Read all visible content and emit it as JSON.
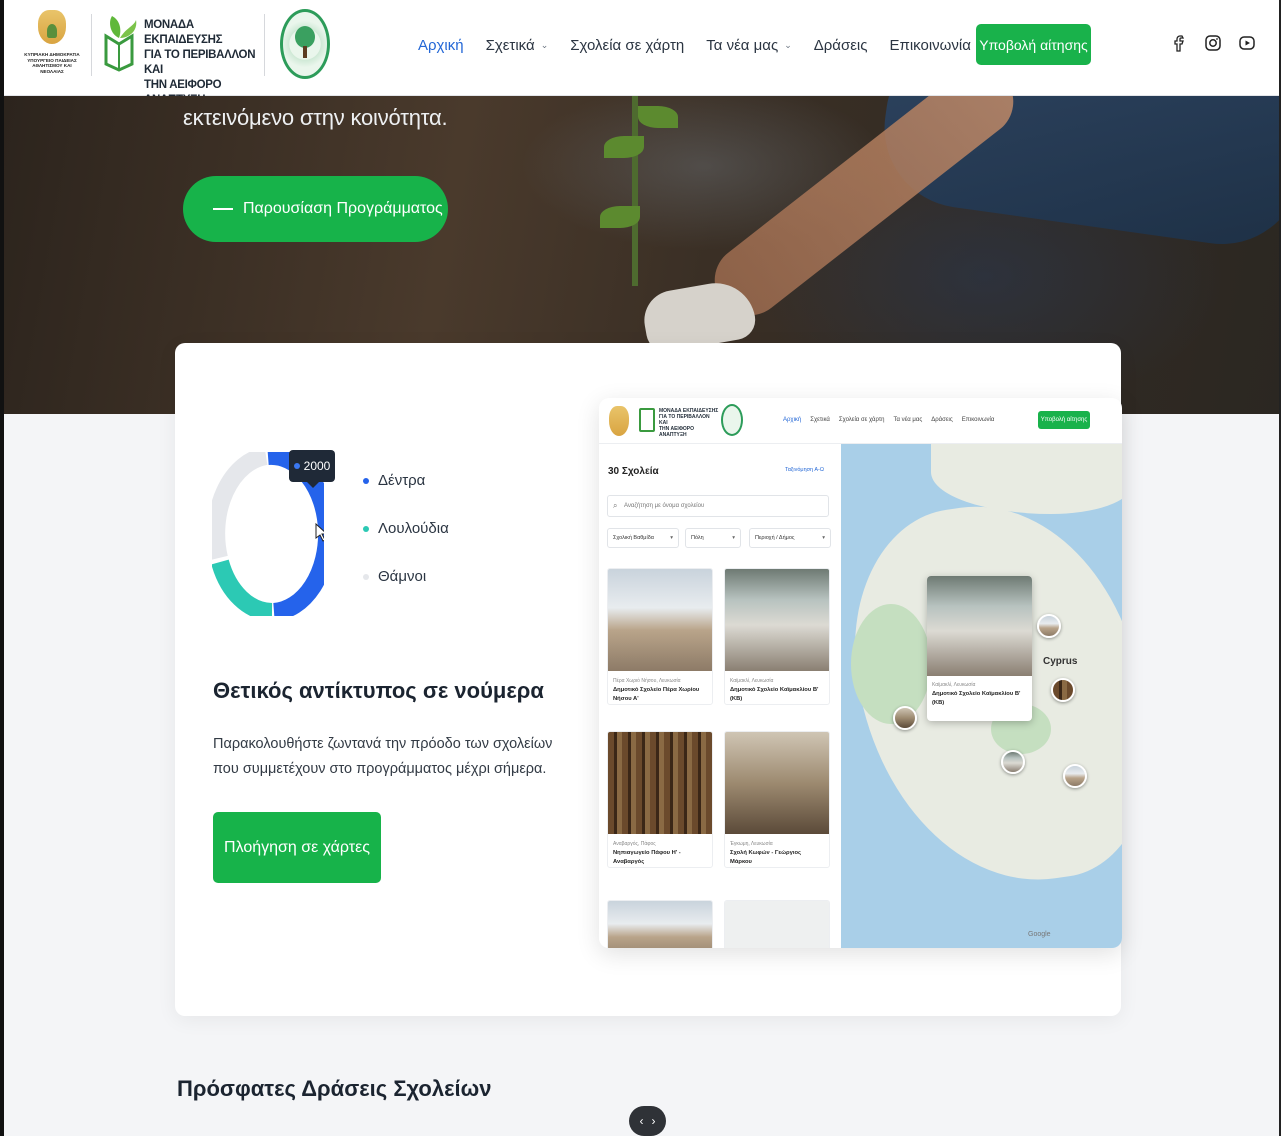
{
  "header": {
    "gov_logo_text": "ΚΥΠΡΙΑΚΗ ΔΗΜΟΚΡΑΤΙΑ ΥΠΟΥΡΓΕΙΟ ΠΑΙΔΕΙΑΣ ΑΘΛΗΤΙΣΜΟΥ ΚΑΙ ΝΕΟΛΑΙΑΣ",
    "unit_name_line1": "ΜΟΝΑΔΑ ΕΚΠΑΙΔΕΥΣΗΣ",
    "unit_name_line2": "ΓΙΑ ΤΟ ΠΕΡΙΒΑΛΛΟΝ ΚΑΙ",
    "unit_name_line3": "ΤΗΝ ΑΕΙΦΟΡΟ ΑΝΑΠΤΥΞΗ",
    "nav": [
      {
        "label": "Αρχική",
        "active": true,
        "dropdown": false
      },
      {
        "label": "Σχετικά",
        "active": false,
        "dropdown": true
      },
      {
        "label": "Σχολεία σε χάρτη",
        "active": false,
        "dropdown": false
      },
      {
        "label": "Τα νέα μας",
        "active": false,
        "dropdown": true
      },
      {
        "label": "Δράσεις",
        "active": false,
        "dropdown": false
      },
      {
        "label": "Επικοινωνία",
        "active": false,
        "dropdown": false
      }
    ],
    "apply_label": "Υποβολή αίτησης",
    "social": [
      "facebook-icon",
      "instagram-icon",
      "youtube-icon"
    ]
  },
  "hero": {
    "text": "εκτεινόμενο στην κοινότητα.",
    "button_label": "Παρουσίαση Προγράμματος"
  },
  "impact": {
    "tooltip_value": "2000",
    "legend": [
      {
        "label": "Δέντρα",
        "color": "#2563eb"
      },
      {
        "label": "Λουλούδια",
        "color": "#2cc9b4"
      },
      {
        "label": "Θάμνοι",
        "color": "#e5e7eb"
      }
    ],
    "title": "Θετικός αντίκτυπος σε νούμερα",
    "description": "Παρακολουθήστε ζωντανά την πρόοδο των σχολείων που συμμετέχουν στο προγράμματος μέχρι σήμερα.",
    "map_button_label": "Πλοήγηση σε χάρτες"
  },
  "preview": {
    "nav": [
      "Αρχική",
      "Σχετικά",
      "Σχολεία σε χάρτη",
      "Τα νέα μας",
      "Δράσεις",
      "Επικοινωνία"
    ],
    "apply_label": "Υποβολή αίτησης",
    "count": "30 Σχολεία",
    "sort": "Ταξινόμηση Α-Ω",
    "search_placeholder": "Αναζήτηση με όνομα σχολείου",
    "filters": [
      "Σχολική Βαθμίδα",
      "Πόλη",
      "Περιοχή / Δήμος"
    ],
    "schools": [
      {
        "location": "Πέρα Χωριό Νήσου, Λευκωσία",
        "name": "Δημοτικό Σχολείο Πέρα Χωρίου Νήσου Α'"
      },
      {
        "location": "Καϊμακλί, Λευκωσία",
        "name": "Δημοτικό Σχολείο Καϊμακλίου Β' (ΚΒ)"
      },
      {
        "location": "Αναβαργός, Πάφος",
        "name": "Νηπιαγωγείο Πάφου Η' - Αναβαργός"
      },
      {
        "location": "Έγκωμη, Λευκωσία",
        "name": "Σχολή Κωφών - Γεώργιος Μάρκου"
      }
    ],
    "map_popup": {
      "location": "Καϊμακλί, Λευκωσία",
      "name": "Δημοτικό Σχολείο Καϊμακλίου Β' (ΚΒ)"
    },
    "map_label": "Cyprus",
    "map_credit": "Google"
  },
  "recent": {
    "title": "Πρόσφατες Δράσεις Σχολείων"
  }
}
